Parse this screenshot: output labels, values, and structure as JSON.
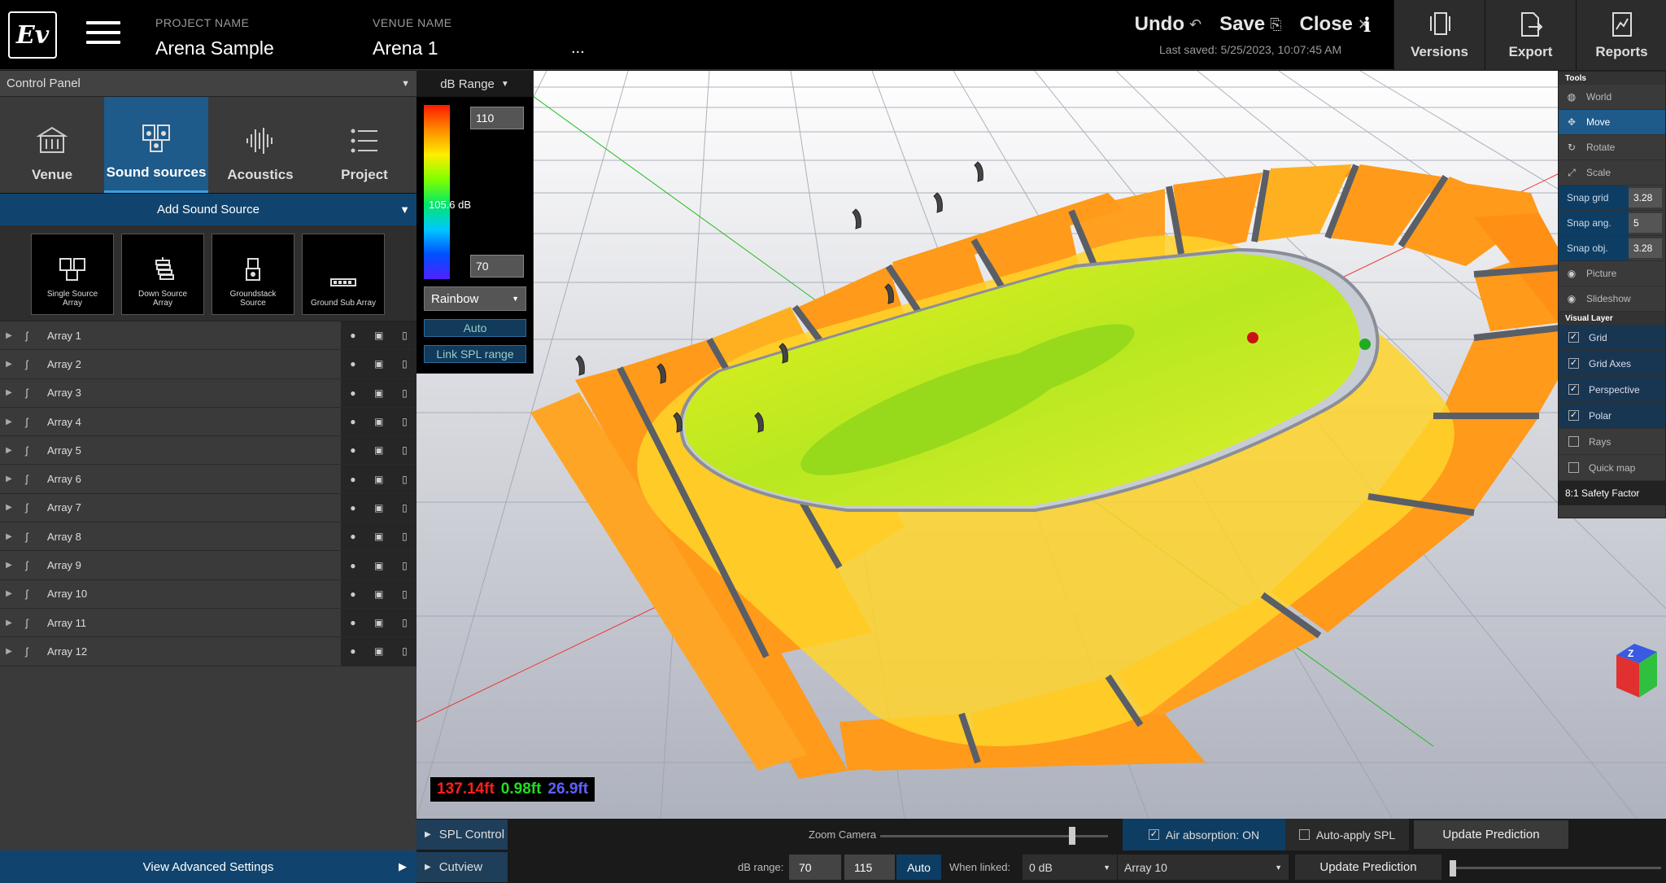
{
  "header": {
    "logo_text": "Ev",
    "project_label": "PROJECT NAME",
    "project_name": "Arena Sample",
    "venue_label": "VENUE NAME",
    "venue_name": "Arena 1",
    "more": "...",
    "undo": "Undo",
    "save": "Save",
    "close": "Close",
    "info": "i",
    "last_saved": "Last saved: 5/25/2023, 10:07:45 AM",
    "right_buttons": [
      "Versions",
      "Export",
      "Reports"
    ]
  },
  "control_panel": {
    "title": "Control Panel",
    "tabs": [
      "Venue",
      "Sound sources",
      "Acoustics",
      "Project"
    ],
    "active_tab": "Sound sources",
    "add_source": "Add Sound Source",
    "source_types": [
      {
        "line1": "Single Source",
        "line2": "Array"
      },
      {
        "line1": "Down Source",
        "line2": "Array"
      },
      {
        "line1": "Groundstack",
        "line2": "Source"
      },
      {
        "line1": "Ground Sub Array",
        "line2": ""
      }
    ],
    "arrays": [
      "Array 1",
      "Array 2",
      "Array 3",
      "Array 4",
      "Array 5",
      "Array 6",
      "Array 7",
      "Array 8",
      "Array 9",
      "Array 10",
      "Array 11",
      "Array 12"
    ],
    "advanced": "View Advanced Settings"
  },
  "db_range": {
    "title": "dB Range",
    "max": "110",
    "mid": "105.6 dB",
    "min": "70",
    "palette": "Rainbow",
    "auto": "Auto",
    "link": "Link SPL range"
  },
  "viewport": {
    "coord_x": "137.14ft",
    "coord_y": "0.98ft",
    "coord_z": "26.9ft",
    "colors": {
      "x": "#ff2020",
      "y": "#22dd22",
      "z": "#6060ff"
    }
  },
  "tools": {
    "section_tools": "Tools",
    "items": [
      "World",
      "Move",
      "Rotate",
      "Scale"
    ],
    "selected": "Move",
    "snaps": [
      {
        "label": "Snap grid",
        "value": "3.28"
      },
      {
        "label": "Snap ang.",
        "value": "5"
      },
      {
        "label": "Snap obj.",
        "value": "3.28"
      }
    ],
    "capture": [
      "Picture",
      "Slideshow"
    ],
    "section_visual": "Visual Layer",
    "layers": [
      {
        "label": "Grid",
        "on": true
      },
      {
        "label": "Grid Axes",
        "on": true
      },
      {
        "label": "Perspective",
        "on": true
      },
      {
        "label": "Polar",
        "on": true
      },
      {
        "label": "Rays",
        "on": false
      },
      {
        "label": "Quick map",
        "on": false
      }
    ],
    "footer": "8:1 Safety Factor"
  },
  "bottom": {
    "spl_control": "SPL Control",
    "cutview": "Cutview",
    "zoom_label": "Zoom Camera",
    "air_absorption": "Air absorption: ON",
    "auto_apply": "Auto-apply SPL",
    "update_prediction": "Update Prediction",
    "db_range_label": "dB range:",
    "db_min": "70",
    "db_max": "115",
    "auto": "Auto",
    "when_linked": "When linked:",
    "linked_value": "0 dB",
    "array_select": "Array 10",
    "update_prediction_2": "Update Prediction"
  }
}
